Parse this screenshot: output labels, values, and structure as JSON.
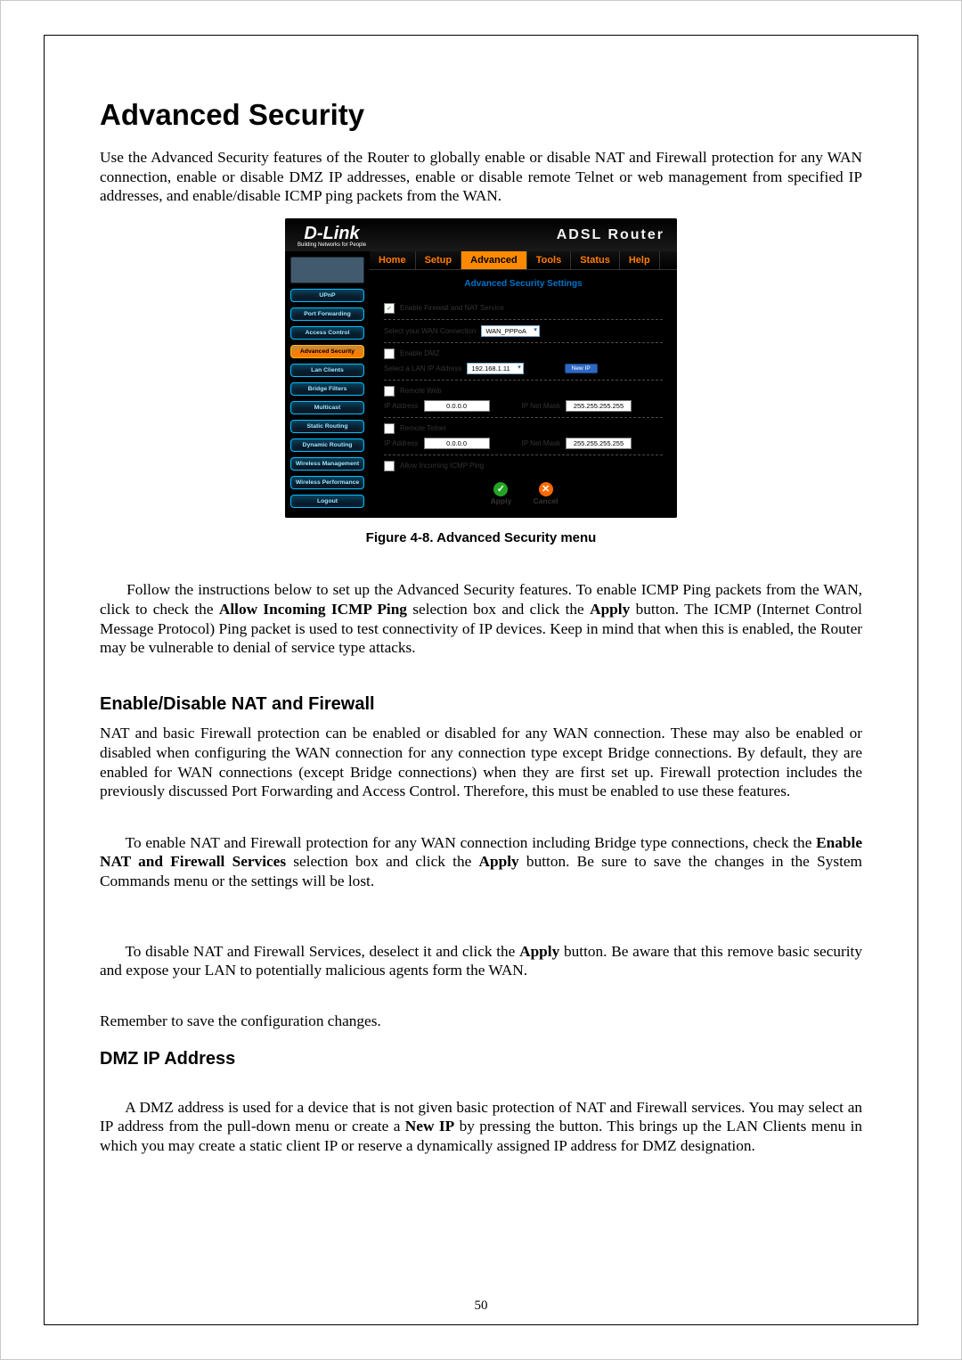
{
  "doc": {
    "title": "Advanced Security",
    "intro": "Use the Advanced Security features of the Router to globally enable or disable NAT and Firewall protection for any WAN connection, enable or disable DMZ IP addresses, enable or disable remote Telnet or web management from specified IP addresses, and enable/disable ICMP ping packets from the WAN.",
    "figure_caption": "Figure 4-8. Advanced Security menu",
    "after_fig_p1a": "Follow the instructions below to set up the Advanced Security features. To enable ICMP Ping packets from the WAN, click to check the ",
    "after_fig_p1b": "Allow Incoming ICMP Ping",
    "after_fig_p1c": " selection box and click the ",
    "after_fig_p1d": "Apply",
    "after_fig_p1e": " button. The ICMP (Internet Control Message Protocol) Ping packet is used to test connectivity of IP devices. Keep in mind that when this is enabled, the Router may be vulnerable to denial of service type attacks.",
    "sub1": "Enable/Disable NAT and Firewall",
    "sub1_p1": "NAT and basic Firewall protection can be enabled or disabled for any WAN connection. These may also be enabled or disabled when configuring the WAN connection for any connection type except Bridge connections. By default, they are enabled for WAN connections (except Bridge connections) when they are first set up. Firewall protection includes the previously discussed Port Forwarding and Access Control. Therefore, this must be enabled to use these features.",
    "sub1_p2a": "To enable NAT and Firewall protection for any WAN connection including Bridge type connections, check the ",
    "sub1_p2b": "Enable NAT and Firewall Services",
    "sub1_p2c": " selection box and click the ",
    "sub1_p2d": "Apply",
    "sub1_p2e": " button. Be sure to save the changes in the System Commands menu or the settings will be lost.",
    "sub1_p3a": "To disable NAT and Firewall Services, deselect it and click the ",
    "sub1_p3b": "Apply",
    "sub1_p3c": " button. Be aware that this remove basic security and expose your LAN to potentially malicious agents form the WAN.",
    "sub1_p4": "Remember to save the configuration changes.",
    "sub2": "DMZ IP Address",
    "sub2_p1a": "A DMZ address is used for a device that is not given basic protection of NAT and Firewall services. You may select an IP address from the pull-down menu or create a ",
    "sub2_p1b": "New IP",
    "sub2_p1c": " by pressing the button. This brings up the LAN Clients menu in which you may create a static client IP or reserve a dynamically assigned IP address for DMZ designation.",
    "page_number": "50"
  },
  "router": {
    "brand": "D-Link",
    "brand_sub": "Building Networks for People",
    "header_title": "ADSL Router",
    "tabs": [
      "Home",
      "Setup",
      "Advanced",
      "Tools",
      "Status",
      "Help"
    ],
    "active_tab": "Advanced",
    "sidebar": [
      "UPnP",
      "Port Forwarding",
      "Access Control",
      "Advanced Security",
      "Lan Clients",
      "Bridge Filters",
      "Multicast",
      "Static Routing",
      "Dynamic Routing",
      "Wireless Management",
      "Wireless Performance",
      "Logout"
    ],
    "sidebar_active": "Advanced Security",
    "section_title": "Advanced Security Settings",
    "enable_fw_label": "Enable Firewall and NAT Service",
    "enable_fw_checked": true,
    "wan_label": "Select your WAN Connection",
    "wan_value": "WAN_PPPoA",
    "enable_dmz_label": "Enable DMZ",
    "lan_ip_label": "Select a LAN IP Address",
    "lan_ip_value": "192.168.1.11",
    "new_ip_btn": "New IP",
    "remote_web_label": "Remote Web",
    "ip_addr_label": "IP Address",
    "remote_web_ip": "0.0.0.0",
    "mask_label": "IP Net Mask",
    "remote_web_mask": "255.255.255.255",
    "remote_telnet_label": "Remote Telnet",
    "remote_telnet_ip": "0.0.0.0",
    "remote_telnet_mask": "255.255.255.255",
    "allow_ping_label": "Allow Incoming ICMP Ping",
    "apply": "Apply",
    "cancel": "Cancel"
  }
}
